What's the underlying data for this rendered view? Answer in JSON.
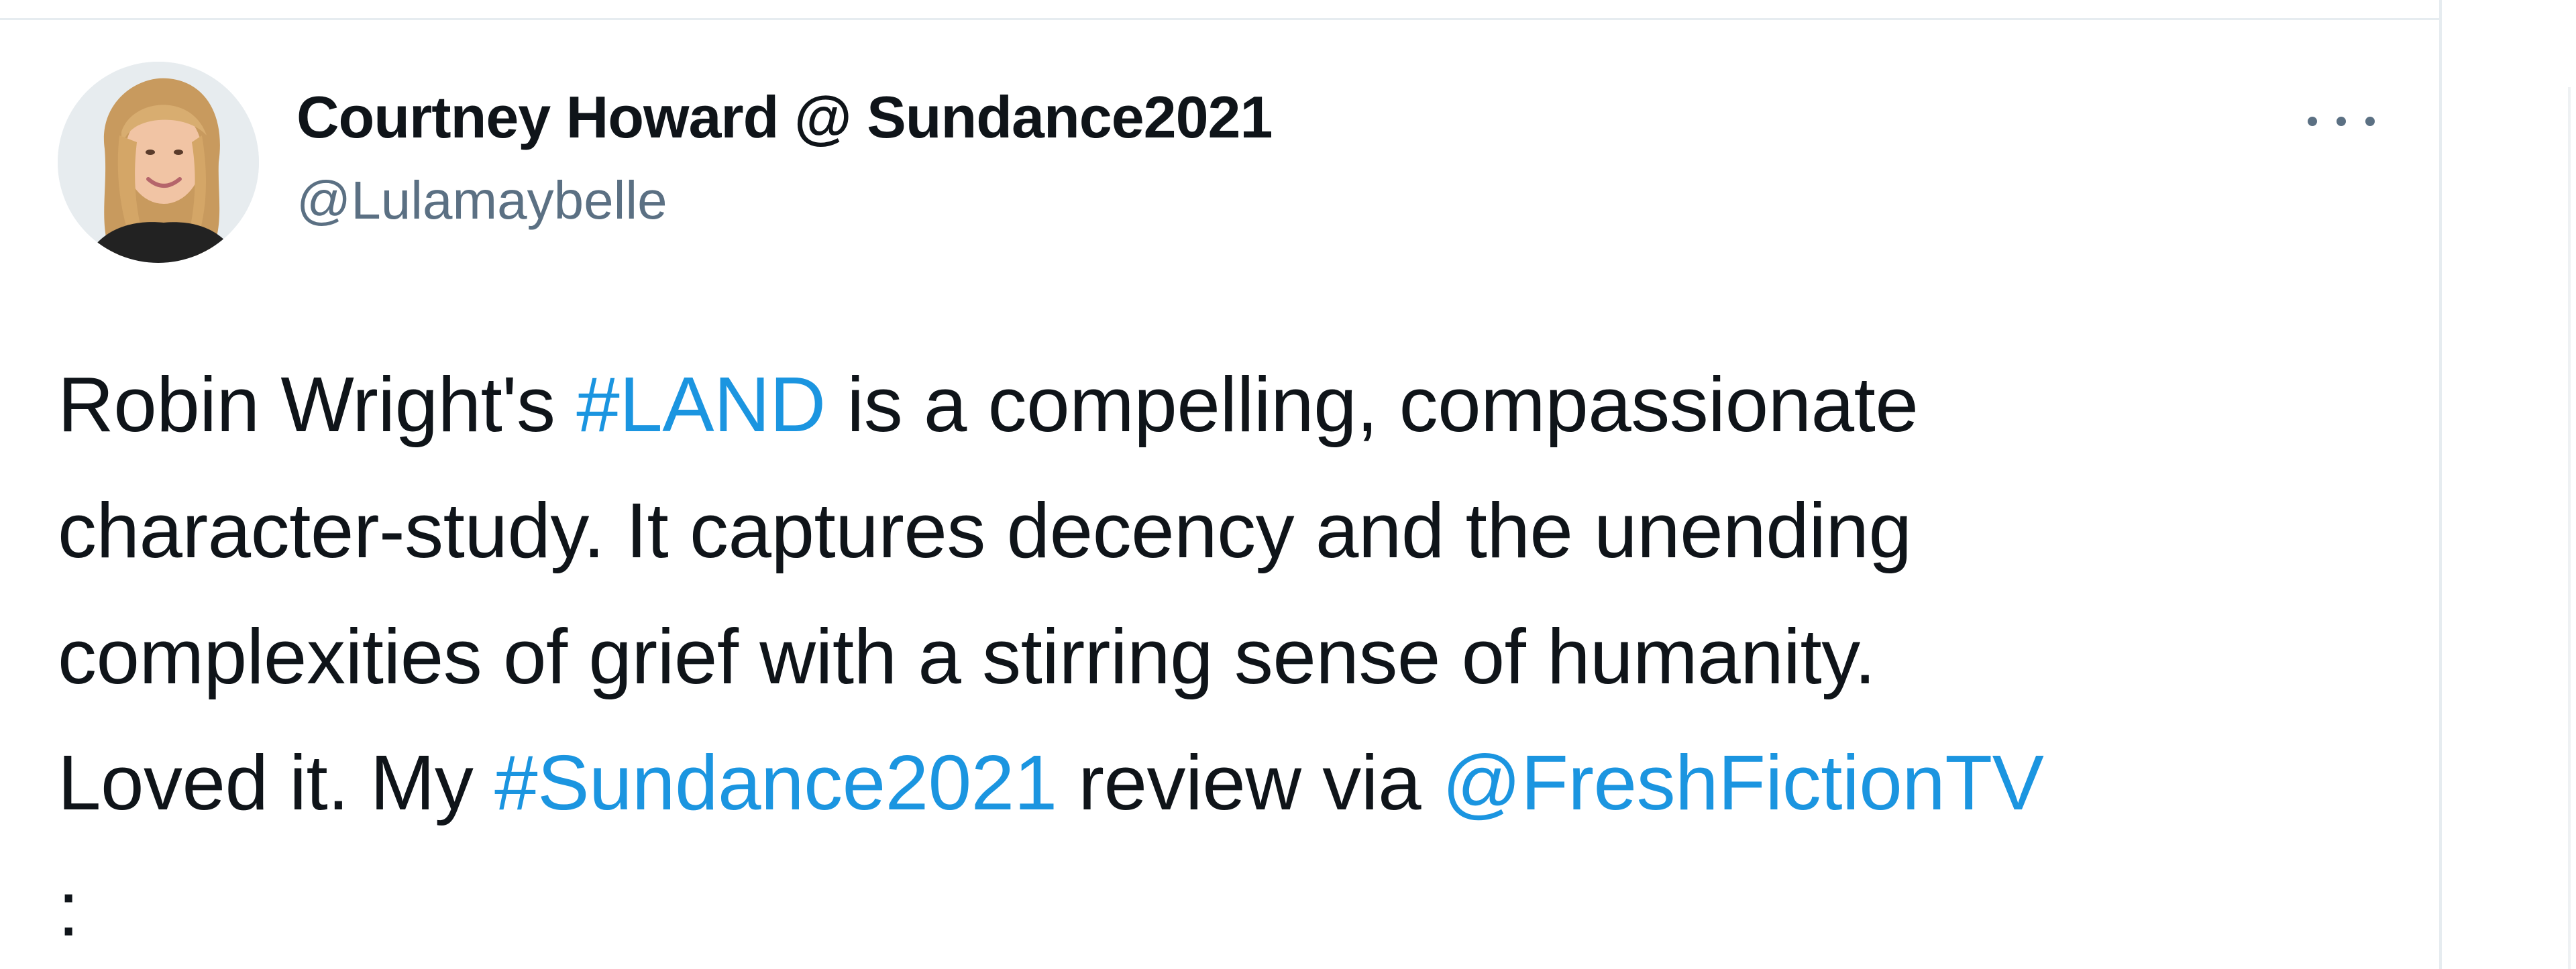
{
  "tweet": {
    "author": {
      "display_name": "Courtney Howard @ Sundance2021",
      "handle": "@Lulamaybelle",
      "avatar_icon": "avatar-photo"
    },
    "more_icon": "more-dots-icon",
    "body": {
      "line1_pre": "Robin Wright's ",
      "hashtag_land": "#LAND",
      "line1_post": " is a compelling, compassionate",
      "line2": "character-study. It captures decency and the unending",
      "line3": "complexities of grief with a stirring sense of humanity.",
      "line4_pre": "Loved it. My ",
      "hashtag_sundance": "#Sundance2021",
      "line4_mid": " review via ",
      "mention_fresh": "@FreshFictionTV",
      "line5": ":"
    }
  },
  "colors": {
    "link": "#1b95e0",
    "text": "#0f1419",
    "secondary": "#5b7083",
    "border": "#e6ecf0"
  }
}
